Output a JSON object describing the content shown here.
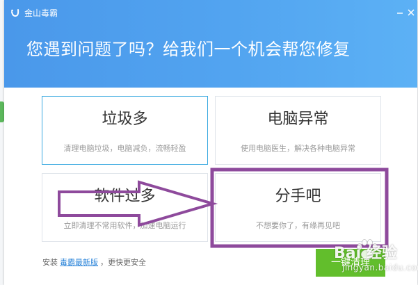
{
  "window": {
    "title": "金山毒霸",
    "minimize_icon": "minimize-icon",
    "close_icon": "close-icon"
  },
  "headline": "您遇到问题了吗？给我们一个机会帮您修复",
  "options": [
    {
      "title": "垃圾多",
      "description": "清理电脑垃圾，电脑减负，流畅轻盈",
      "selected": true
    },
    {
      "title": "电脑异常",
      "description": "使用电脑医生，解决各种电脑异常",
      "selected": false
    },
    {
      "title": "软件过多",
      "description": "立即清理不常用软件，加速电脑运行",
      "selected": false
    },
    {
      "title": "分手吧",
      "description": "不想要你了，有缘再见吧",
      "selected": false
    }
  ],
  "install": {
    "prefix": "安装",
    "link": "毒霸最新版",
    "suffix": "，更快更安全"
  },
  "action_button": "一键清理",
  "watermark": {
    "main": "Bai 经验",
    "sub": "jingyan.baidu.com"
  },
  "colors": {
    "header_blue": "#4a98ea",
    "selected_border": "#39a9e0",
    "link_blue": "#2b84d9",
    "button_green": "#62be2c",
    "annotation_purple": "#8e4a9c"
  }
}
